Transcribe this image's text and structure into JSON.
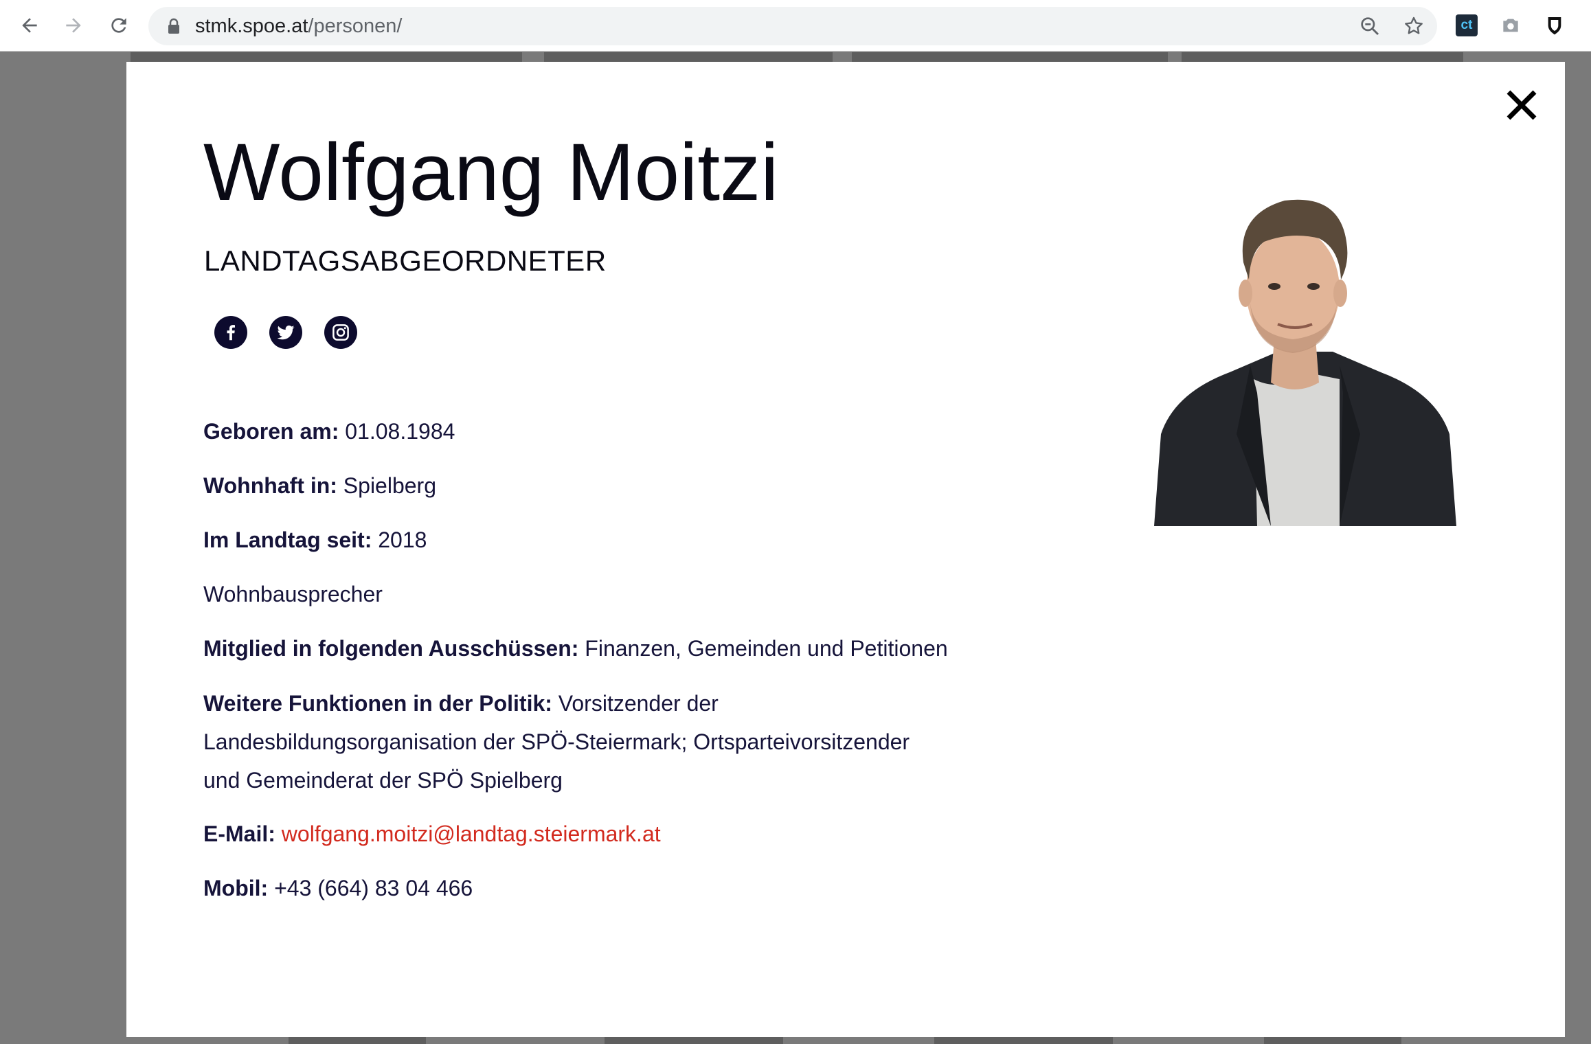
{
  "browser": {
    "url_host": "stmk.spoe.at",
    "url_path": "/personen/",
    "icons": [
      "back-arrow-icon",
      "forward-arrow-icon",
      "reload-icon",
      "lock-icon",
      "zoom-icon",
      "star-icon",
      "extension-ct-icon",
      "camera-icon",
      "shield-icon"
    ],
    "extension_ct_label": "ct"
  },
  "profile": {
    "name": "Wolfgang Moitzi",
    "role": "LANDTAGSABGEORDNETER",
    "social": [
      "facebook-icon",
      "twitter-icon",
      "instagram-icon"
    ],
    "born_label": "Geboren am:",
    "born_value": "01.08.1984",
    "residence_label": "Wohnhaft in:",
    "residence_value": "Spielberg",
    "landtag_label": "Im Landtag seit:",
    "landtag_value": "2018",
    "speaker": "Wohnbausprecher",
    "committees_label": "Mitglied in folgenden Ausschüssen:",
    "committees_value": "Finanzen, Gemeinden und Petitionen",
    "functions_label": "Weitere Funktionen in der Politik:",
    "functions_line1": "Vorsitzender der",
    "functions_line2": "Landesbildungsorganisation der SPÖ-Steiermark; Ortsparteivorsitzender",
    "functions_line3": "und Gemeinderat der SPÖ Spielberg",
    "email_label": "E-Mail:",
    "email_value": "wolfgang.moitzi@landtag.steiermark.at",
    "mobile_label": "Mobil:",
    "mobile_value": "+43 (664) 83 04 466"
  },
  "colors": {
    "text": "#16143a",
    "link": "#d22a1e",
    "social_bg": "#0d0b2e",
    "overlay": "#7a7a7a"
  }
}
